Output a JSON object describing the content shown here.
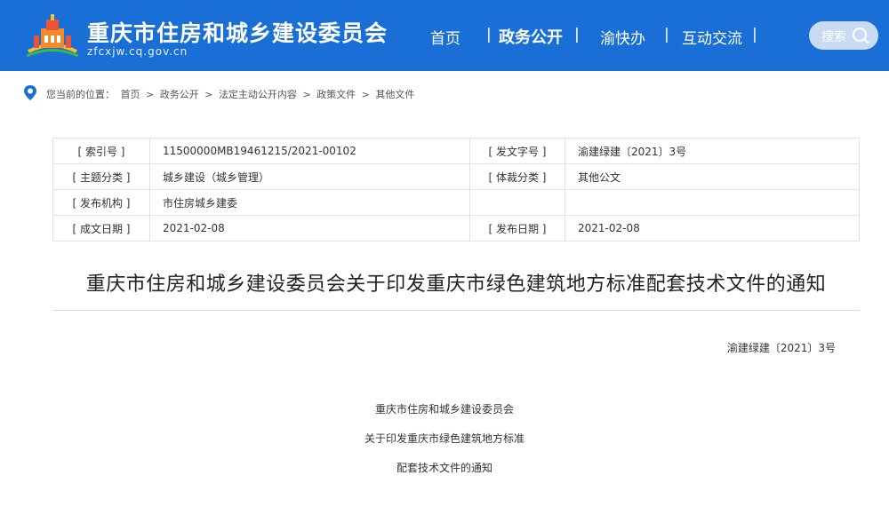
{
  "header": {
    "site_title": "重庆市住房和城乡建设委员会",
    "site_domain": "zfcxjw.cq.gov.cn",
    "nav": {
      "home": "首页",
      "gov_affairs": "政务公开",
      "yukuaiban": "渝快办",
      "interaction": "互动交流",
      "separator": "|"
    },
    "search_label": "搜索",
    "colors": {
      "header_bg": "#1a6fd6"
    }
  },
  "breadcrumb": {
    "prefix": "您当前的位置：",
    "items": [
      "首页",
      "政务公开",
      "法定主动公开内容",
      "政策文件",
      "其他文件"
    ],
    "separator": ">"
  },
  "meta": {
    "index_no_label": "[ 索引号 ]",
    "index_no_value": "11500000MB19461215/2021-00102",
    "doc_no_label": "[ 发文字号 ]",
    "doc_no_value": "渝建绿建〔2021〕3号",
    "topic_label": "[ 主题分类 ]",
    "topic_value": "城乡建设（城乡管理）",
    "genre_label": "[ 体裁分类 ]",
    "genre_value": "其他公文",
    "issuer_label": "[ 发布机构 ]",
    "issuer_value": "市住房城乡建委",
    "written_label": "[ 成文日期 ]",
    "written_value": "2021-02-08",
    "published_label": "[ 发布日期 ]",
    "published_value": "2021-02-08"
  },
  "document": {
    "title": "重庆市住房和城乡建设委员会关于印发重庆市绿色建筑地方标准配套技术文件的通知",
    "doc_number": "渝建绿建〔2021〕3号",
    "heading_lines": [
      "重庆市住房和城乡建设委员会",
      "关于印发重庆市绿色建筑地方标准",
      "配套技术文件的通知"
    ]
  }
}
